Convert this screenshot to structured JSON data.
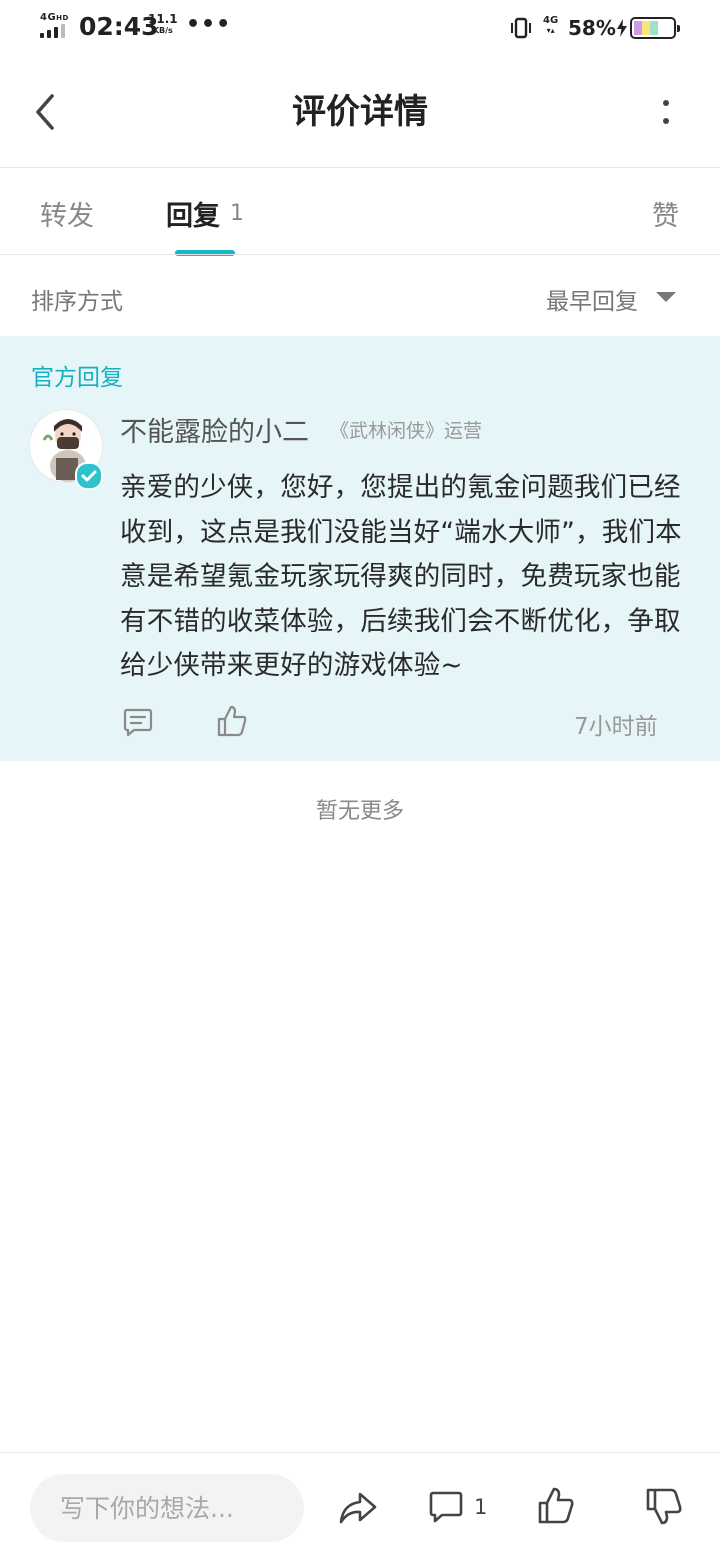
{
  "status_bar": {
    "network": "4G",
    "network_hd": "HD",
    "time": "02:43",
    "speed_value": "11.1",
    "speed_unit": "KB/s",
    "more": "•••",
    "cell_type": "4G",
    "battery_percent": "58%",
    "battery_level": 0.58
  },
  "header": {
    "title": "评价详情",
    "back_icon": "chevron-left-icon",
    "more_icon": "vertical-dots-icon"
  },
  "tabs": [
    {
      "label": "转发"
    },
    {
      "label": "回复",
      "count": "1",
      "active": true
    },
    {
      "label": "赞"
    }
  ],
  "sort": {
    "label": "排序方式",
    "value": "最早回复"
  },
  "official_reply": {
    "section_label": "官方回复",
    "author": "不能露脸的小二",
    "author_tag": "《武林闲侠》运营",
    "content": "亲爱的少侠，您好，您提出的氪金问题我们已经收到，这点是我们没能当好“端水大师”，我们本意是希望氪金玩家玩得爽的同时，免费玩家也能有不错的收菜体验，后续我们会不断优化，争取给少侠带来更好的游戏体验~",
    "time": "7小时前"
  },
  "list_end": "暂无更多",
  "bottom_bar": {
    "input_placeholder": "写下你的想法...",
    "comment_count": "1"
  },
  "colors": {
    "accent": "#15b8c7",
    "card_bg": "#e6f5f7",
    "official_label": "#15b0c1"
  }
}
